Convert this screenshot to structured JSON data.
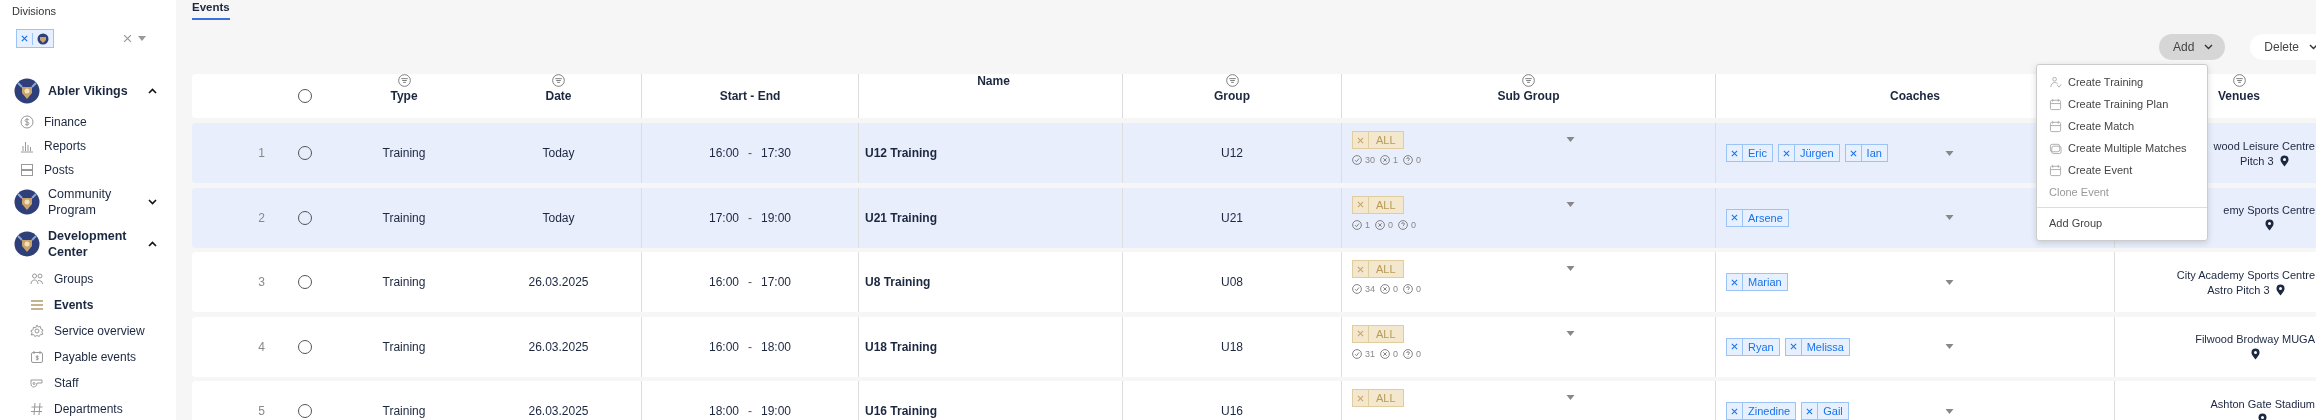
{
  "sidebar": {
    "divisions_label": "Divisions",
    "organizations": [
      {
        "name": "Abler Vikings",
        "expanded": true,
        "items": [
          {
            "label": "Finance",
            "selected": false
          },
          {
            "label": "Reports",
            "selected": false
          },
          {
            "label": "Posts",
            "selected": false
          }
        ]
      },
      {
        "name": "Community Program",
        "expanded": false
      },
      {
        "name": "Development Center",
        "expanded": true,
        "items": [
          {
            "label": "Groups",
            "selected": false
          },
          {
            "label": "Events",
            "selected": true
          },
          {
            "label": "Service overview",
            "selected": false
          },
          {
            "label": "Payable events",
            "selected": false
          },
          {
            "label": "Staff",
            "selected": false
          },
          {
            "label": "Departments",
            "selected": false
          }
        ]
      }
    ]
  },
  "tabs": [
    {
      "label": "Events",
      "selected": true
    }
  ],
  "toolbar": [
    {
      "label": "Add",
      "active": true
    },
    {
      "label": "Delete",
      "active": false
    }
  ],
  "add_menu": [
    {
      "label": "Create Training",
      "kind": "action",
      "disabled": false
    },
    {
      "label": "Create Training Plan",
      "kind": "action",
      "disabled": false
    },
    {
      "label": "Create Match",
      "kind": "action",
      "disabled": false
    },
    {
      "label": "Create Multiple Matches",
      "kind": "action",
      "disabled": false
    },
    {
      "label": "Create Event",
      "kind": "action",
      "disabled": false
    },
    {
      "label": "Clone Event",
      "kind": "action",
      "disabled": true
    },
    {
      "label": "Add Group",
      "kind": "section",
      "disabled": false
    }
  ],
  "table": {
    "select_all": {
      "selected": false
    },
    "columns": [
      {
        "label": "Type",
        "filter": true
      },
      {
        "label": "Date",
        "filter": true
      },
      {
        "label": "Start - End",
        "filter": false
      },
      {
        "label": "Name",
        "filter": false
      },
      {
        "label": "Group",
        "filter": true
      },
      {
        "label": "Sub Group",
        "filter": true
      },
      {
        "label": "Coaches",
        "filter": false
      },
      {
        "label": "Venues",
        "filter": true
      }
    ],
    "rows": [
      {
        "number": "1",
        "selected": false,
        "highlighted": true,
        "type": "Training",
        "date": "Today",
        "start": "16:00",
        "sep": "-",
        "end": "17:30",
        "name": "U12 Training",
        "group": "U12",
        "subgroups": [
          "ALL"
        ],
        "counts": [
          "30",
          "1",
          "0"
        ],
        "coaches": [
          "Eric",
          "Jürgen",
          "Ian"
        ],
        "venue": [
          "wood Leisure Centre",
          "Pitch 3"
        ]
      },
      {
        "number": "2",
        "selected": false,
        "highlighted": true,
        "type": "Training",
        "date": "Today",
        "start": "17:00",
        "sep": "-",
        "end": "19:00",
        "name": "U21 Training",
        "group": "U21",
        "subgroups": [
          "ALL"
        ],
        "counts": [
          "1",
          "0",
          "0"
        ],
        "coaches": [
          "Arsene"
        ],
        "venue": [
          "emy Sports Centre"
        ]
      },
      {
        "number": "3",
        "selected": false,
        "highlighted": false,
        "type": "Training",
        "date": "26.03.2025",
        "start": "16:00",
        "sep": "-",
        "end": "17:00",
        "name": "U8 Training",
        "group": "U08",
        "subgroups": [
          "ALL"
        ],
        "counts": [
          "34",
          "0",
          "0"
        ],
        "coaches": [
          "Marian"
        ],
        "venue": [
          "City Academy Sports Centre",
          "Astro Pitch 3"
        ]
      },
      {
        "number": "4",
        "selected": false,
        "highlighted": false,
        "type": "Training",
        "date": "26.03.2025",
        "start": "16:00",
        "sep": "-",
        "end": "18:00",
        "name": "U18 Training",
        "group": "U18",
        "subgroups": [
          "ALL"
        ],
        "counts": [
          "31",
          "0",
          "0"
        ],
        "coaches": [
          "Ryan",
          "Melissa"
        ],
        "venue": [
          "Filwood Brodway MUGA"
        ]
      },
      {
        "number": "5",
        "selected": false,
        "highlighted": false,
        "type": "Training",
        "date": "26.03.2025",
        "start": "18:00",
        "sep": "-",
        "end": "19:00",
        "name": "U16 Training",
        "group": "U16",
        "subgroups": [
          "ALL"
        ],
        "coaches": [
          "Zinedine",
          "Gail"
        ],
        "venue": [
          "Ashton Gate Stadium"
        ]
      }
    ]
  }
}
